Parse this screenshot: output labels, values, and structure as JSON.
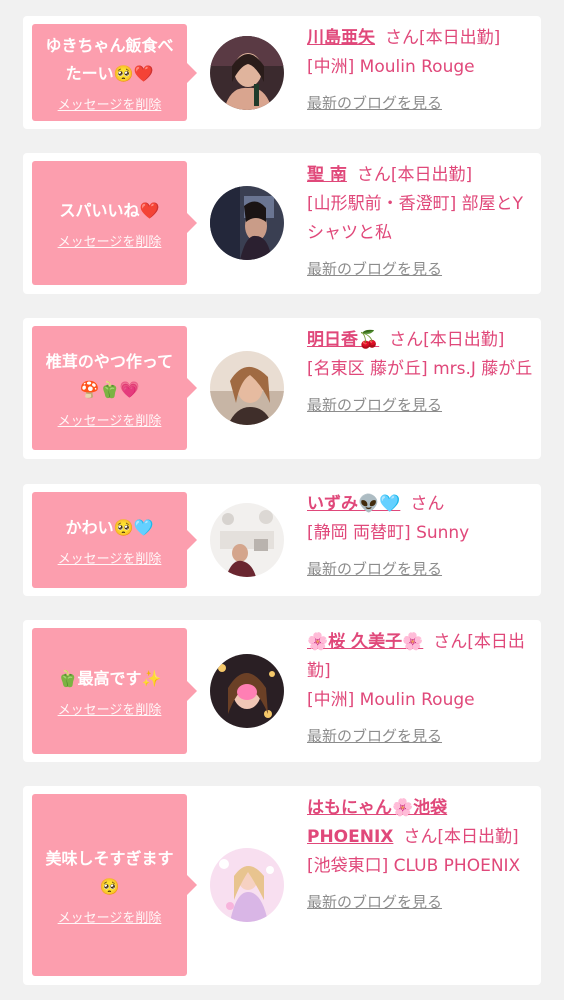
{
  "delete_label": "メッセージを削除",
  "blog_label": "最新のブログを見る",
  "messages": [
    {
      "message_line1": "ゆきちゃん飯食べ",
      "message_line2": "たーい🥺❤️",
      "name": "川島亜矢",
      "status": "さん[本日出勤]",
      "shop": "[中洲] Moulin Rouge"
    },
    {
      "message_line1": "スパいいね❤️",
      "message_line2": "",
      "name": "聖 南",
      "status": "さん[本日出勤]",
      "shop": "[山形駅前・香澄町] 部屋とYシャツと私"
    },
    {
      "message_line1": "椎茸のやつ作って",
      "message_line2": "🍄🫑💗",
      "name": "明日香🍒",
      "status": "さん[本日出勤]",
      "shop": "[名東区 藤が丘] mrs.J 藤が丘"
    },
    {
      "message_line1": "かわい🥺🩵",
      "message_line2": "",
      "name": "いずみ👽🩵",
      "status": "さん",
      "shop": "[静岡 両替町] Sunny"
    },
    {
      "message_line1": "🫑最高です✨",
      "message_line2": "",
      "name": "🌸桜 久美子🌸",
      "status": "さん[本日出勤]",
      "shop": "[中洲] Moulin Rouge"
    },
    {
      "message_line1": "美味しそすぎます",
      "message_line2": "🥺",
      "name": "はもにゃん🌸池袋PHOENIX",
      "status": "さん[本日出勤]",
      "shop": "[池袋東口] CLUB PHOENIX"
    }
  ],
  "colors": {
    "bubble": "#fc9eae",
    "accent_text": "#e0487a",
    "blog_link": "#8c8c8c",
    "background": "#f1f1f1",
    "card": "#ffffff"
  }
}
